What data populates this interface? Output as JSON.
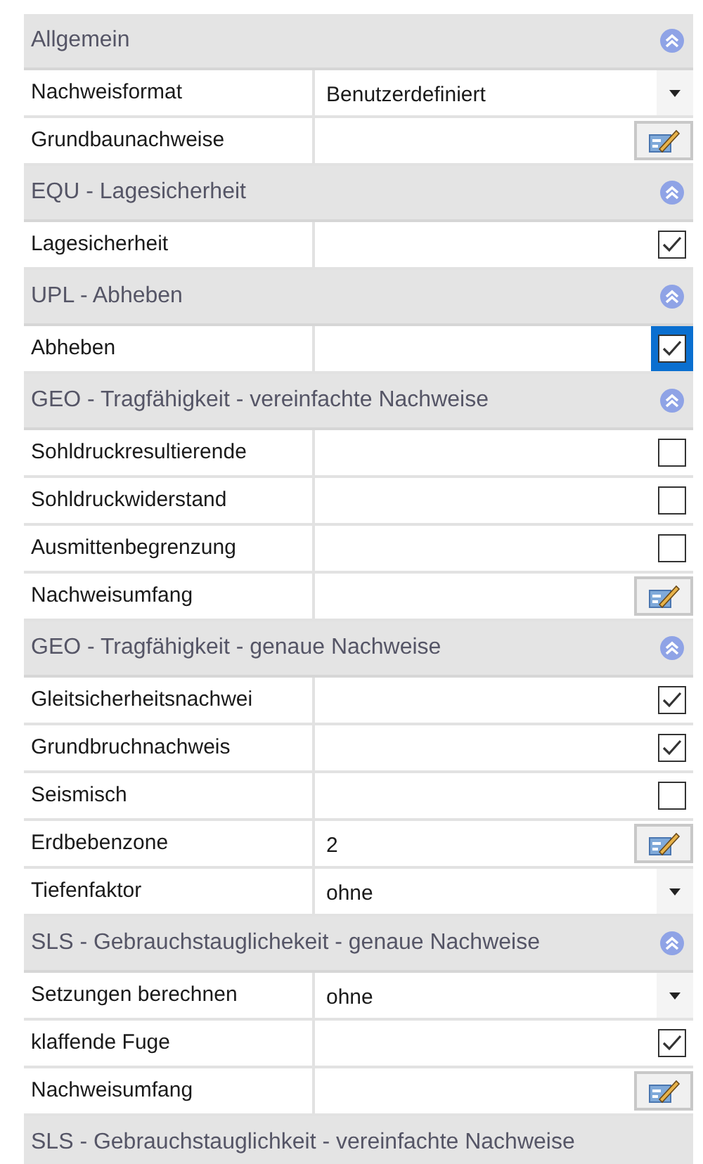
{
  "sections": [
    {
      "title": "Allgemein",
      "toggle": true,
      "rows": [
        {
          "label": "Nachweisformat",
          "kind": "dropdown",
          "value": "Benutzerdefiniert",
          "selected": false
        },
        {
          "label": "Grundbaunachweise",
          "kind": "edit",
          "selected": false
        }
      ]
    },
    {
      "title": "EQU - Lagesicherheit",
      "toggle": true,
      "rows": [
        {
          "label": "Lagesicherheit",
          "kind": "checkbox",
          "checked": true,
          "selected": false
        }
      ]
    },
    {
      "title": "UPL - Abheben",
      "toggle": true,
      "rows": [
        {
          "label": "Abheben",
          "kind": "checkbox",
          "checked": true,
          "selected": true
        }
      ]
    },
    {
      "title": "GEO - Tragfähigkeit - vereinfachte Nachweise",
      "toggle": true,
      "rows": [
        {
          "label": "Sohldruckresultierende",
          "kind": "checkbox",
          "checked": false,
          "selected": false
        },
        {
          "label": "Sohldruckwiderstand",
          "kind": "checkbox",
          "checked": false,
          "selected": false
        },
        {
          "label": "Ausmittenbegrenzung",
          "kind": "checkbox",
          "checked": false,
          "selected": false
        },
        {
          "label": "Nachweisumfang",
          "kind": "edit",
          "selected": false
        }
      ]
    },
    {
      "title": "GEO - Tragfähigkeit - genaue Nachweise",
      "toggle": true,
      "rows": [
        {
          "label": "Gleitsicherheitsnachwei",
          "kind": "checkbox",
          "checked": true,
          "selected": false
        },
        {
          "label": "Grundbruchnachweis",
          "kind": "checkbox",
          "checked": true,
          "selected": false
        },
        {
          "label": "Seismisch",
          "kind": "checkbox",
          "checked": false,
          "selected": false
        },
        {
          "label": "Erdbebenzone",
          "kind": "edit",
          "value": "2",
          "selected": false
        },
        {
          "label": "Tiefenfaktor",
          "kind": "dropdown",
          "value": "ohne",
          "selected": false
        }
      ]
    },
    {
      "title": "SLS - Gebrauchstauglichekeit - genaue Nachweise",
      "toggle": true,
      "rows": [
        {
          "label": "Setzungen berechnen",
          "kind": "dropdown",
          "value": "ohne",
          "selected": false
        },
        {
          "label": "klaffende Fuge",
          "kind": "checkbox",
          "checked": true,
          "selected": false
        },
        {
          "label": "Nachweisumfang",
          "kind": "edit",
          "selected": false
        }
      ]
    },
    {
      "title": "SLS - Gebrauchstauglichkeit - vereinfachte Nachweise",
      "toggle": false
    }
  ]
}
